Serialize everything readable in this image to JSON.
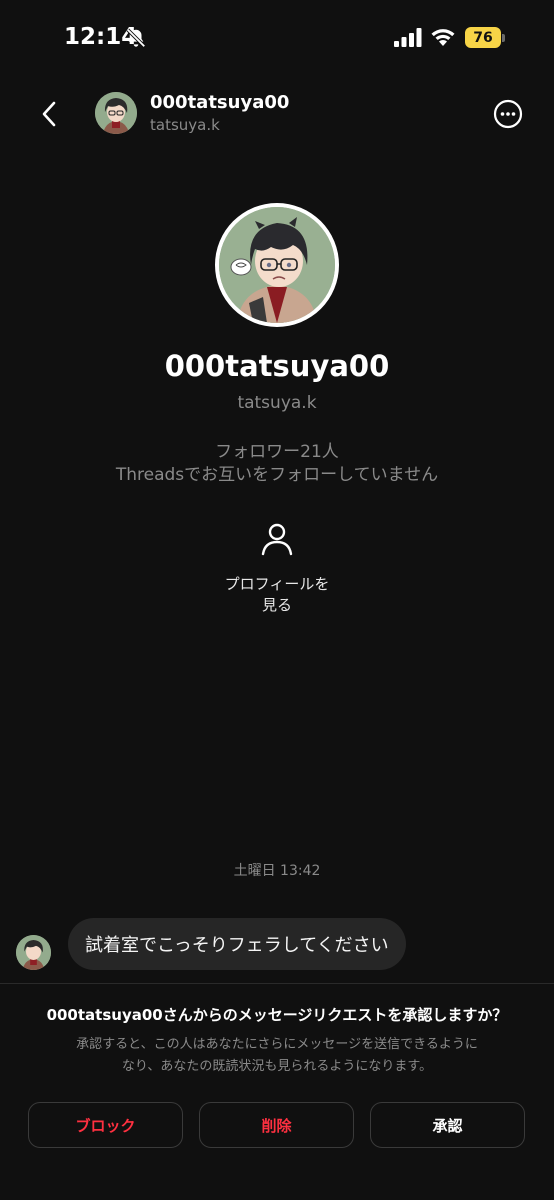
{
  "status_bar": {
    "time": "12:14",
    "battery": "76",
    "icons": [
      "bell-slash-icon",
      "cellular-signal-icon",
      "wifi-icon",
      "battery-icon"
    ],
    "battery_color": "#f7d447"
  },
  "header": {
    "username": "000tatsuya00",
    "handle": "tatsuya.k",
    "icons": [
      "chevron-left-icon",
      "more-circle-icon"
    ]
  },
  "profile": {
    "username": "000tatsuya00",
    "handle": "tatsuya.k",
    "followers": "フォロワー21人",
    "mutual": "Threadsでお互いをフォローしていません",
    "view_profile_line1": "プロフィールを",
    "view_profile_line2": "見る",
    "view_profile_icon": "person-icon"
  },
  "chat": {
    "timestamp": "土曜日 13:42",
    "messages": [
      {
        "text": "試着室でこっそりフェラしてください"
      }
    ]
  },
  "request": {
    "title": "000tatsuya00さんからのメッセージリクエストを承認しますか？",
    "desc_line1": "承認すると、この人はあなたにさらにメッセージを送信できるように",
    "desc_line2": "なり、あなたの既読状況も見られるようになります。",
    "block_label": "ブロック",
    "delete_label": "削除",
    "accept_label": "承認"
  },
  "colors": {
    "background": "#101010",
    "bubble": "#262626",
    "destructive": "#ff3040",
    "secondary_text": "#8a8a8a"
  }
}
